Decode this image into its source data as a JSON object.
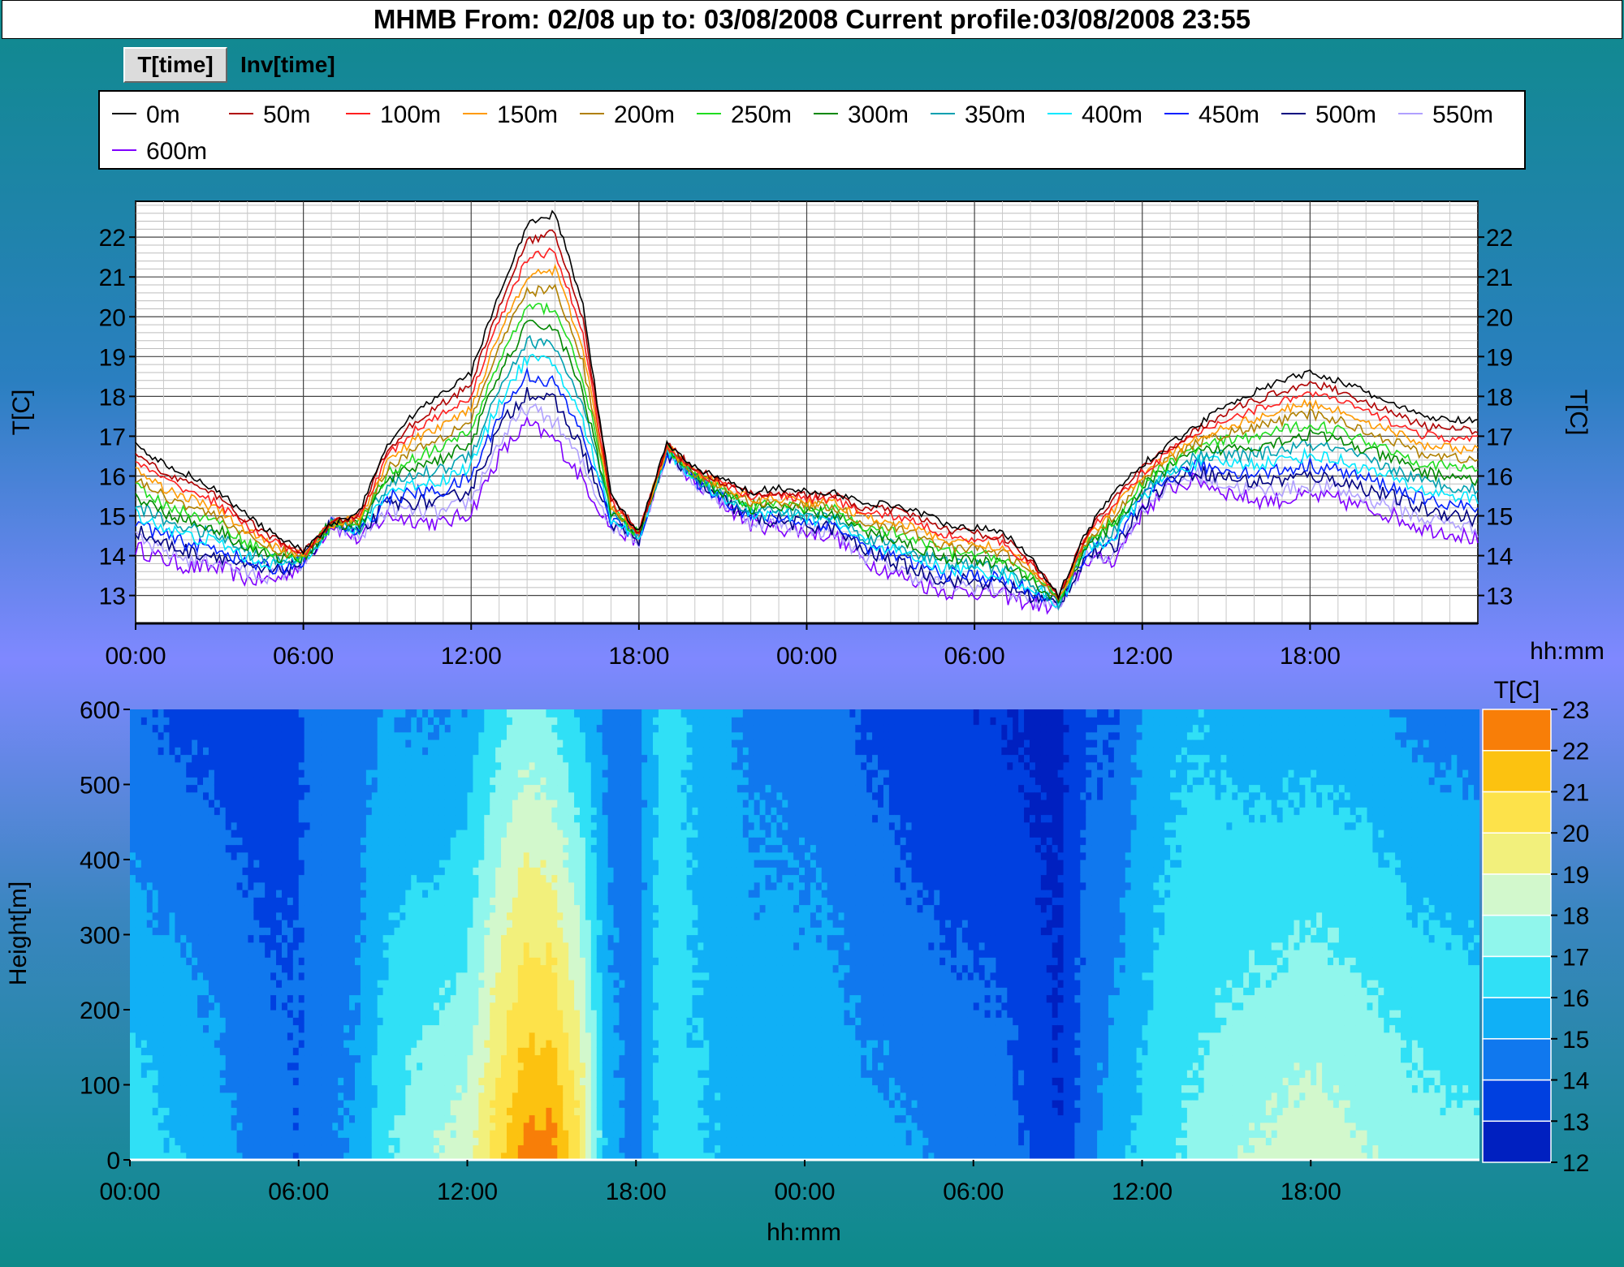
{
  "title": "MHMB  From: 02/08 up to: 03/08/2008 Current profile:03/08/2008 23:55",
  "tabs": [
    "T[time]",
    "Inv[time]"
  ],
  "colors": {
    "series": [
      "#000000",
      "#b00000",
      "#ff2020",
      "#ff9a00",
      "#b08000",
      "#20dd20",
      "#008800",
      "#00a0b0",
      "#00e8ff",
      "#0020ff",
      "#000080",
      "#b0a0ff",
      "#8000ff"
    ],
    "contour": [
      "#0020c0",
      "#0040e0",
      "#1078ee",
      "#10b0f6",
      "#30e0f6",
      "#90f6ec",
      "#d2f8cc",
      "#f2f07c",
      "#fde24a",
      "#fcc210",
      "#f87e08",
      "#e02408"
    ]
  },
  "chart_data": [
    {
      "type": "line",
      "ylabel": "T[C]",
      "xlabel": "hh:mm",
      "ylim": [
        12.3,
        22.9
      ],
      "yticks": [
        13,
        14,
        15,
        16,
        17,
        18,
        19,
        20,
        21,
        22
      ],
      "xlim_hours": [
        0,
        48
      ],
      "xticks": [
        "00:00",
        "06:00",
        "12:00",
        "18:00",
        "00:00",
        "06:00",
        "12:00",
        "18:00"
      ],
      "grid": true,
      "legend": "top",
      "series_names": [
        "0m",
        "50m",
        "100m",
        "150m",
        "200m",
        "250m",
        "300m",
        "350m",
        "400m",
        "450m",
        "500m",
        "550m",
        "600m"
      ],
      "x_hours": [
        0,
        1,
        2,
        3,
        4,
        5,
        6,
        7,
        8,
        9,
        10,
        11,
        12,
        13,
        14,
        15,
        16,
        17,
        18,
        19,
        20,
        21,
        22,
        23,
        24,
        25,
        26,
        27,
        28,
        29,
        30,
        31,
        32,
        33,
        34,
        35,
        36,
        37,
        38,
        39,
        40,
        41,
        42,
        43,
        44,
        45,
        46,
        47,
        48
      ],
      "surface": [
        16.8,
        16.3,
        16.0,
        15.6,
        15.0,
        14.5,
        14.1,
        14.8,
        15.1,
        16.8,
        17.6,
        18.1,
        18.6,
        20.6,
        22.3,
        22.6,
        20.3,
        15.5,
        14.6,
        16.8,
        16.2,
        15.9,
        15.6,
        15.7,
        15.6,
        15.6,
        15.3,
        15.3,
        15.1,
        14.8,
        14.7,
        14.6,
        14.0,
        13.0,
        14.6,
        15.6,
        16.3,
        16.8,
        17.3,
        17.8,
        18.1,
        18.4,
        18.6,
        18.4,
        18.1,
        17.8,
        17.5,
        17.4,
        17.4
      ],
      "top_offset": [
        -2.6,
        -2.4,
        -2.3,
        -1.9,
        -1.6,
        -1.1,
        -0.3,
        0.0,
        -0.7,
        -1.8,
        -2.7,
        -3.3,
        -3.5,
        -4.1,
        -5.0,
        -5.7,
        -4.4,
        -0.8,
        -0.2,
        -0.2,
        -0.4,
        -0.6,
        -0.8,
        -1.0,
        -1.0,
        -1.1,
        -1.4,
        -1.7,
        -1.8,
        -1.7,
        -1.6,
        -1.6,
        -1.2,
        -0.3,
        -0.7,
        -1.7,
        -1.2,
        -1.1,
        -1.4,
        -2.2,
        -2.7,
        -3.0,
        -3.1,
        -3.0,
        -2.9,
        -2.8,
        -2.8,
        -2.8,
        -3.0
      ]
    },
    {
      "type": "heatmap",
      "ylabel": "Height[m]",
      "xlabel": "hh:mm",
      "ylim": [
        0,
        600
      ],
      "yticks": [
        0,
        100,
        200,
        300,
        400,
        500,
        600
      ],
      "xticks": [
        "00:00",
        "06:00",
        "12:00",
        "18:00",
        "00:00",
        "06:00",
        "12:00",
        "18:00"
      ],
      "colorbar_title": "T[C]",
      "colorbar_levels": [
        12,
        13,
        14,
        15,
        16,
        17,
        18,
        19,
        20,
        21,
        22,
        23
      ]
    }
  ]
}
